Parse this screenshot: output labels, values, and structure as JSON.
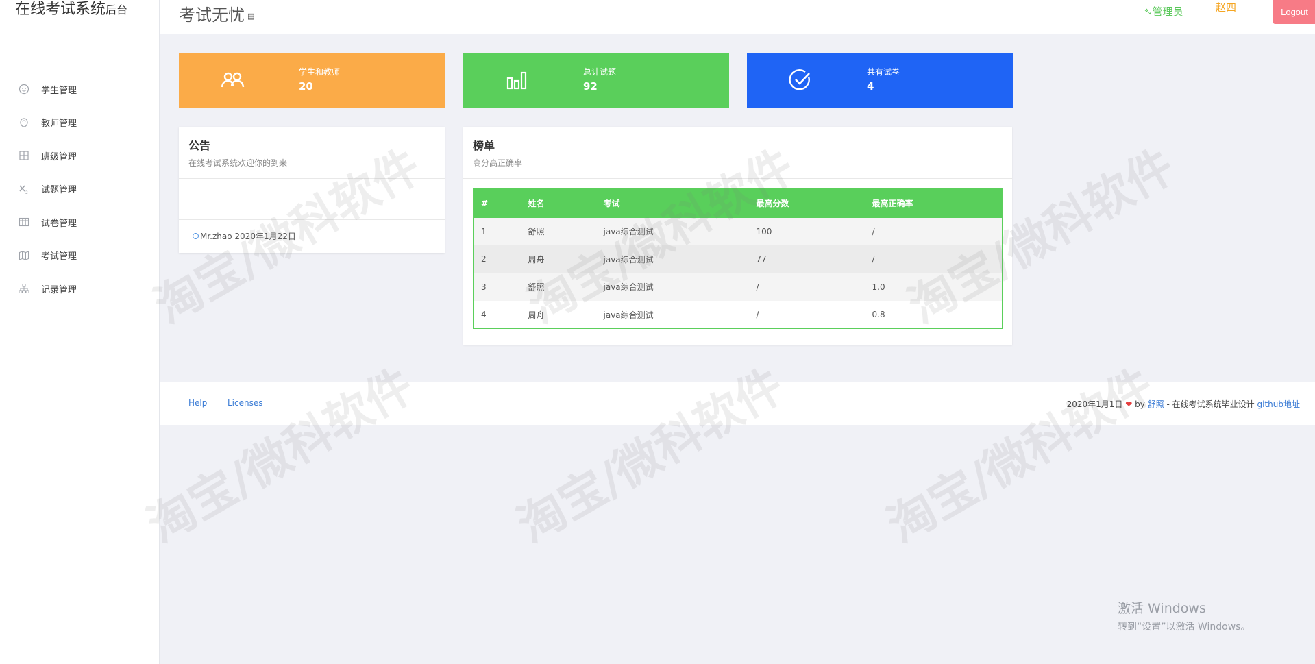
{
  "brand": {
    "main": "在线考试系统",
    "suffix": "后台"
  },
  "sidebar": {
    "items": [
      {
        "label": "学生管理",
        "icon": "student-icon"
      },
      {
        "label": "教师管理",
        "icon": "teacher-icon"
      },
      {
        "label": "班级管理",
        "icon": "grid-icon"
      },
      {
        "label": "试题管理",
        "icon": "formula-icon"
      },
      {
        "label": "试卷管理",
        "icon": "table-icon"
      },
      {
        "label": "考试管理",
        "icon": "map-icon"
      },
      {
        "label": "记录管理",
        "icon": "sitemap-icon"
      }
    ]
  },
  "header": {
    "title": "考试无忧",
    "role": "管理员",
    "username": "赵四",
    "logout": "Logout"
  },
  "stats": [
    {
      "label": "学生和教师",
      "value": "20",
      "color": "#fbab48",
      "icon": "users-icon"
    },
    {
      "label": "总计试题",
      "value": "92",
      "color": "#5acf5b",
      "icon": "bar-chart-icon"
    },
    {
      "label": "共有试卷",
      "value": "4",
      "color": "#1f64f5",
      "icon": "check-circle-icon"
    }
  ],
  "notice": {
    "title": "公告",
    "subtitle": "在线考试系统欢迎你的到来",
    "footer": "Mr.zhao 2020年1月22日"
  },
  "ranking": {
    "title": "榜单",
    "subtitle": "高分高正确率",
    "columns": [
      "#",
      "姓名",
      "考试",
      "最高分数",
      "最高正确率"
    ],
    "rows": [
      [
        "1",
        "舒照",
        "java综合测试",
        "100",
        "/"
      ],
      [
        "2",
        "周舟",
        "java综合测试",
        "77",
        "/"
      ],
      [
        "3",
        "舒照",
        "java综合测试",
        "/",
        "1.0"
      ],
      [
        "4",
        "周舟",
        "java综合测试",
        "/",
        "0.8"
      ]
    ]
  },
  "footer": {
    "help": "Help",
    "licenses": "Licenses",
    "date": "2020年1月1日",
    "by": "by",
    "author": "舒照",
    "sep": "- 在线考试系统毕业设计",
    "github": "github地址"
  },
  "watermark": "淘宝/微科软件",
  "windows_activation": {
    "line1": "激活 Windows",
    "line2": "转到“设置”以激活 Windows。"
  }
}
